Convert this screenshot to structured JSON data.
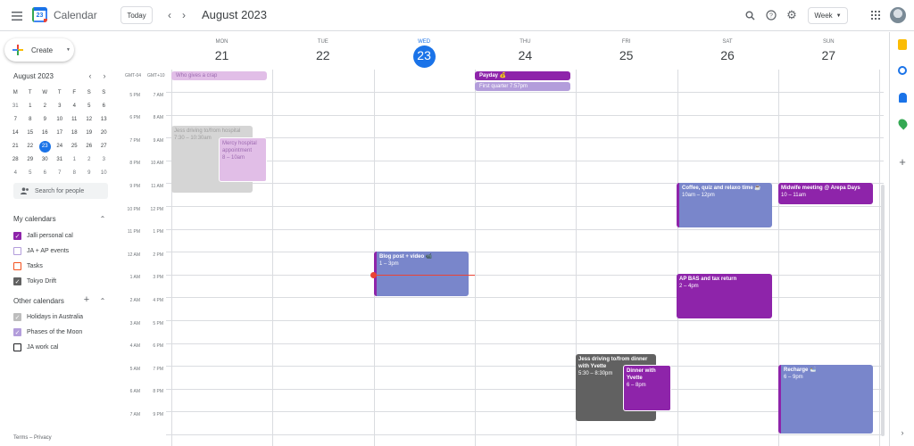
{
  "header": {
    "app_name": "Calendar",
    "logo_text": "23",
    "today_label": "Today",
    "title": "August 2023",
    "view_label": "Week"
  },
  "sidebar": {
    "create_label": "Create",
    "mini_title": "August 2023",
    "weekday_initials": [
      "M",
      "T",
      "W",
      "T",
      "F",
      "S",
      "S"
    ],
    "mini_weeks": [
      [
        "31",
        "1",
        "2",
        "3",
        "4",
        "5",
        "6"
      ],
      [
        "7",
        "8",
        "9",
        "10",
        "11",
        "12",
        "13"
      ],
      [
        "14",
        "15",
        "16",
        "17",
        "18",
        "19",
        "20"
      ],
      [
        "21",
        "22",
        "23",
        "24",
        "25",
        "26",
        "27"
      ],
      [
        "28",
        "29",
        "30",
        "31",
        "1",
        "2",
        "3"
      ],
      [
        "4",
        "5",
        "6",
        "7",
        "8",
        "9",
        "10"
      ]
    ],
    "search_placeholder": "Search for people",
    "my_calendars_title": "My calendars",
    "my_calendars": [
      {
        "label": "Jalli personal cal",
        "color": "#8e24aa",
        "checked": true
      },
      {
        "label": "JA + AP events",
        "color": "#b39ddb",
        "checked": false
      },
      {
        "label": "Tasks",
        "color": "#f4511e",
        "checked": false
      },
      {
        "label": "Tokyo Drift",
        "color": "#616161",
        "checked": true
      }
    ],
    "other_calendars_title": "Other calendars",
    "other_calendars": [
      {
        "label": "Holidays in Australia",
        "color": "#bdbdbd",
        "checked": true
      },
      {
        "label": "Phases of the Moon",
        "color": "#b39ddb",
        "checked": true
      },
      {
        "label": "JA work cal",
        "color": "#202124",
        "checked": false
      }
    ],
    "terms": "Terms – Privacy"
  },
  "grid": {
    "tz_labels": [
      "GMT-04",
      "GMT+10"
    ],
    "days": [
      {
        "name": "MON",
        "num": "21"
      },
      {
        "name": "TUE",
        "num": "22"
      },
      {
        "name": "WED",
        "num": "23",
        "today": true
      },
      {
        "name": "THU",
        "num": "24"
      },
      {
        "name": "FRI",
        "num": "25"
      },
      {
        "name": "SAT",
        "num": "26"
      },
      {
        "name": "SUN",
        "num": "27"
      }
    ],
    "times_left": [
      "5 PM",
      "6 PM",
      "7 PM",
      "8 PM",
      "9 PM",
      "10 PM",
      "11 PM",
      "12 AM",
      "1 AM",
      "2 AM",
      "3 AM",
      "4 AM",
      "5 AM",
      "6 AM",
      "7 AM"
    ],
    "times_right": [
      "7 AM",
      "8 AM",
      "9 AM",
      "10 AM",
      "11 AM",
      "12 PM",
      "1 PM",
      "2 PM",
      "3 PM",
      "4 PM",
      "5 PM",
      "6 PM",
      "7 PM",
      "8 PM",
      "9 PM"
    ]
  },
  "events": {
    "who_gives": {
      "title": "Who gives a crap"
    },
    "payday": {
      "title": "Payday 💰"
    },
    "first_quarter": {
      "title": "First quarter 7:57pm"
    },
    "jess_hospital": {
      "title": "Jess driving to/from hospital",
      "time": "7:30 – 10:30am"
    },
    "mercy": {
      "title": "Mercy hospital appointment",
      "time": "8 – 10am"
    },
    "blog": {
      "title": "Blog post + video 📹",
      "time": "1 – 3pm"
    },
    "coffee": {
      "title": "Coffee, quiz and relaxo time ☕",
      "time": "10am – 12pm"
    },
    "midwife": {
      "title": "Midwife meeting @ Arepa Days",
      "time": "10 – 11am"
    },
    "ap_bas": {
      "title": "AP BAS and tax return",
      "time": "2 – 4pm"
    },
    "jess_dinner": {
      "title": "Jess driving to/from dinner with Yvette",
      "time": "5:30 – 8:30pm"
    },
    "dinner": {
      "title": "Dinner with Yvette",
      "time": "6 – 8pm"
    },
    "recharge": {
      "title": "Recharge 🛀",
      "time": "6 – 9pm"
    }
  }
}
